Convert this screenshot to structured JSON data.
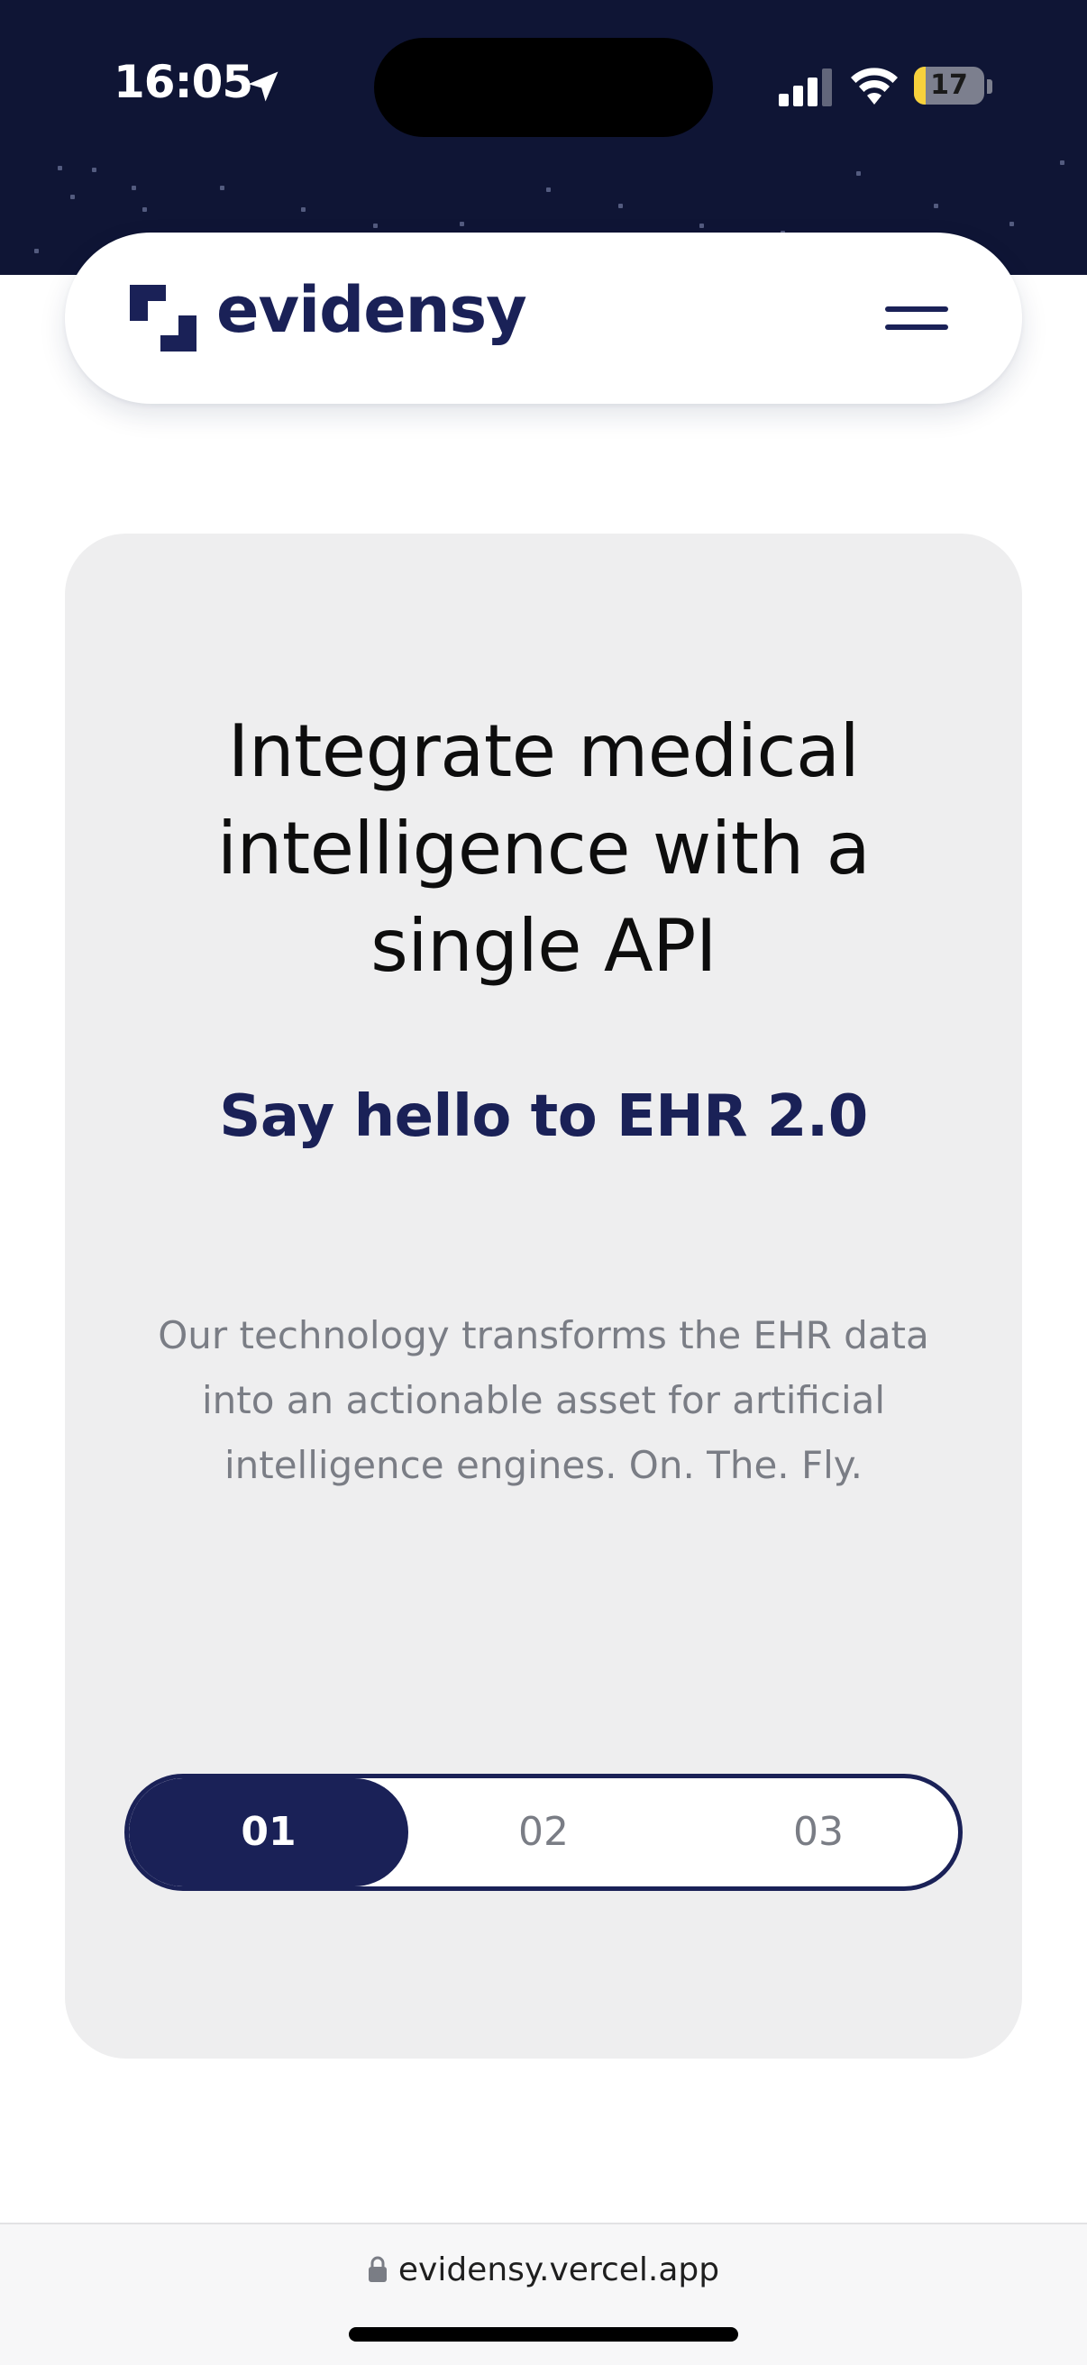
{
  "status_bar": {
    "time": "16:05",
    "battery_level": "17",
    "battery_color": "#f7d13c"
  },
  "navbar": {
    "logo_text": "evidensy",
    "menu_icon": "hamburger-menu-icon"
  },
  "hero": {
    "title": "Integrate medical intelligence with a single API",
    "subtitle": "Say hello to EHR 2.0",
    "body": "Our technology transforms the EHR data into an actionable asset for artificial intelligence engines. On. The. Fly."
  },
  "slides": {
    "tabs": [
      {
        "label": "01",
        "active": true
      },
      {
        "label": "02",
        "active": false
      },
      {
        "label": "03",
        "active": false
      }
    ]
  },
  "browser": {
    "url": "evidensy.vercel.app"
  },
  "colors": {
    "brand_navy": "#1a2157",
    "header_background": "#0f1535",
    "card_background": "#eeeeef",
    "body_text": "#7a7d85"
  }
}
